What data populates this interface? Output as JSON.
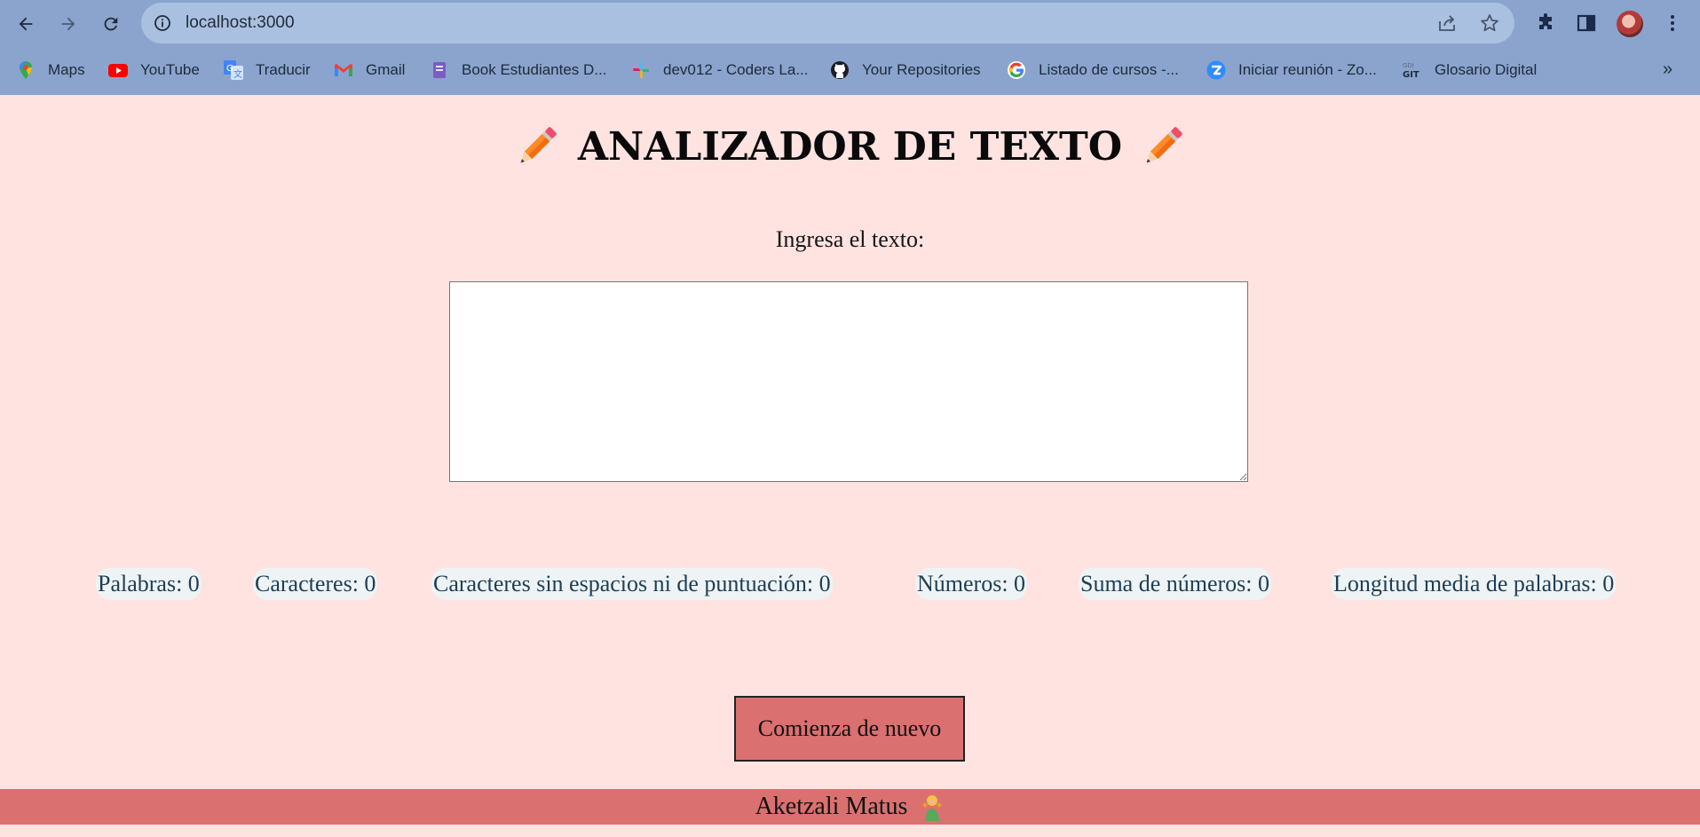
{
  "browser": {
    "url": "localhost:3000",
    "bookmarks": [
      {
        "label": "Maps",
        "icon": "maps-icon"
      },
      {
        "label": "YouTube",
        "icon": "youtube-icon"
      },
      {
        "label": "Traducir",
        "icon": "translate-icon"
      },
      {
        "label": "Gmail",
        "icon": "gmail-icon"
      },
      {
        "label": "Book Estudiantes D...",
        "icon": "book-icon"
      },
      {
        "label": "dev012 - Coders La...",
        "icon": "slack-icon"
      },
      {
        "label": "Your Repositories",
        "icon": "github-icon"
      },
      {
        "label": "Listado de cursos -...",
        "icon": "google-icon"
      },
      {
        "label": "Iniciar reunión - Zo...",
        "icon": "zoom-icon"
      },
      {
        "label": "Glosario Digital",
        "icon": "glosario-icon"
      }
    ],
    "more_label": "»"
  },
  "page": {
    "title": "ANALIZADOR DE TEXTO",
    "input_label": "Ingresa el texto:",
    "textarea_value": "",
    "metrics": [
      {
        "label": "Palabras: 0"
      },
      {
        "label": "Caracteres: 0"
      },
      {
        "label": "Caracteres sin espacios ni de puntuación: 0"
      },
      {
        "label": "Números: 0"
      },
      {
        "label": "Suma de números: 0"
      },
      {
        "label": "Longitud media de palabras: 0"
      }
    ],
    "restart_label": "Comienza de nuevo",
    "footer_author": "Aketzali Matus"
  },
  "colors": {
    "page_bg": "#ffe3e1",
    "accent": "#db7070",
    "chrome": "#8aa4ce",
    "metric_bg": "#eef4f5",
    "metric_text": "#1e3d54"
  }
}
